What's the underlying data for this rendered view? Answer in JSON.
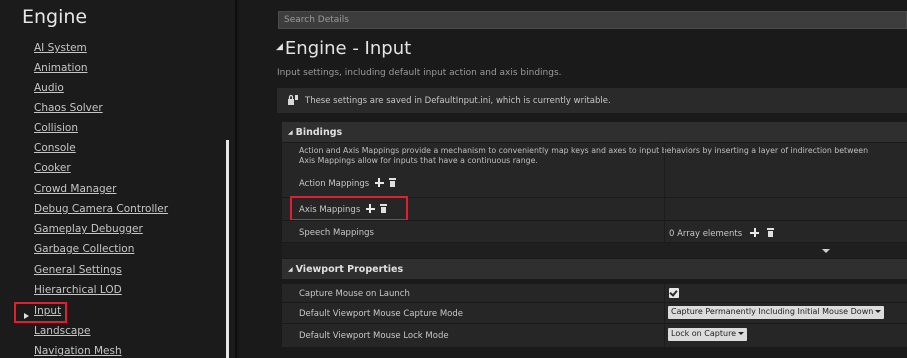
{
  "sidebar": {
    "title": "Engine",
    "items": [
      {
        "label": "AI System"
      },
      {
        "label": "Animation"
      },
      {
        "label": "Audio"
      },
      {
        "label": "Chaos Solver"
      },
      {
        "label": "Collision"
      },
      {
        "label": "Console"
      },
      {
        "label": "Cooker"
      },
      {
        "label": "Crowd Manager"
      },
      {
        "label": "Debug Camera Controller"
      },
      {
        "label": "Gameplay Debugger"
      },
      {
        "label": "Garbage Collection"
      },
      {
        "label": "General Settings"
      },
      {
        "label": "Hierarchical LOD"
      },
      {
        "label": "Input",
        "selected": true
      },
      {
        "label": "Landscape"
      },
      {
        "label": "Navigation Mesh"
      }
    ]
  },
  "search": {
    "placeholder": "Search Details"
  },
  "page": {
    "title": "Engine - Input",
    "description": "Input settings, including default input action and axis bindings.",
    "notice": "These settings are saved in DefaultInput.ini, which is currently writable."
  },
  "bindings": {
    "header": "Bindings",
    "desc_line1": "Action and Axis Mappings provide a mechanism to conveniently map keys and axes to input behaviors by inserting a layer of indirection between",
    "desc_line2": "Axis Mappings allow for inputs that have a continuous range.",
    "action_mappings": "Action Mappings",
    "axis_mappings": "Axis Mappings",
    "speech_mappings": "Speech Mappings",
    "speech_value": "0 Array elements"
  },
  "viewport": {
    "header": "Viewport Properties",
    "capture_mouse_label": "Capture Mouse on Launch",
    "capture_mouse_checked": true,
    "capture_mode_label": "Default Viewport Mouse Capture Mode",
    "capture_mode_value": "Capture Permanently Including Initial Mouse Down",
    "lock_mode_label": "Default Viewport Mouse Lock Mode",
    "lock_mode_value": "Lock on Capture"
  },
  "colors": {
    "highlight": "#e0202f",
    "background": "#1a1a1a",
    "row": "#262626"
  }
}
